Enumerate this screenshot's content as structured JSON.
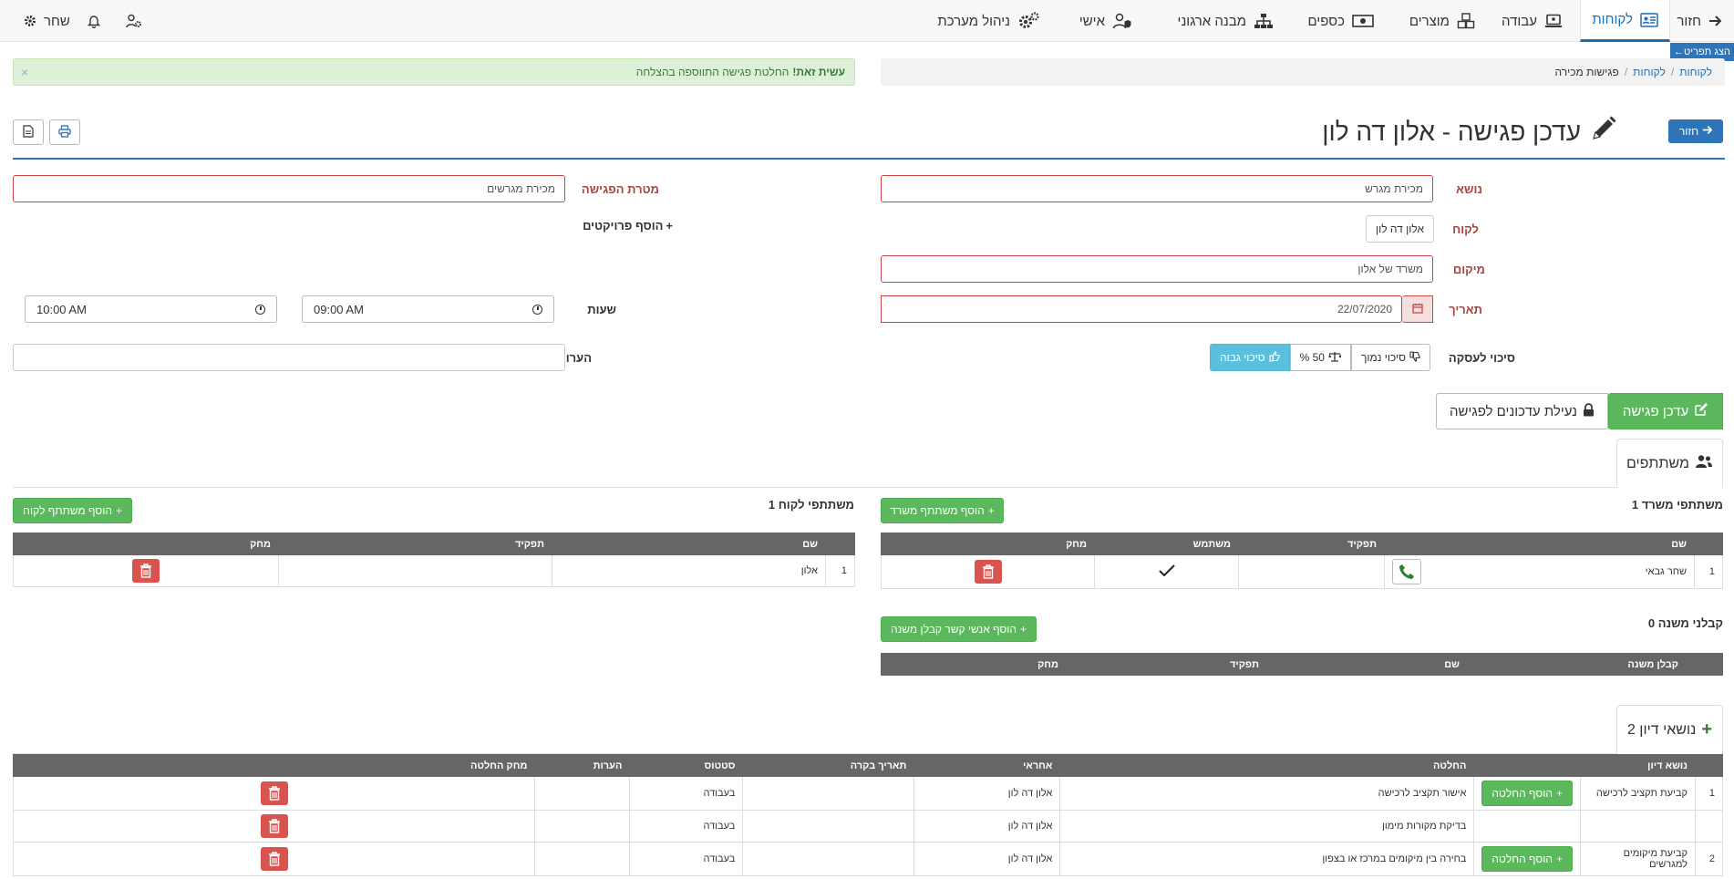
{
  "nav": {
    "back": "חזור",
    "customers": "לקוחות",
    "work": "עבודה",
    "products": "מוצרים",
    "finance": "כספים",
    "org": "מבנה ארגוני",
    "personal": "אישי",
    "admin": "ניהול מערכת",
    "user": "שחר",
    "show_params": "הצג תפריט←"
  },
  "breadcrumb": [
    "לקוחות",
    "לקוחות",
    "פגישות מכירה"
  ],
  "alert": {
    "strong": "עשית זאת!",
    "text": "החלטת פגישה התווספה בהצלחה",
    "close": "×"
  },
  "header": {
    "back": "חזור",
    "title": "עדכן פגישה - אלון דה לון"
  },
  "form": {
    "subject_label": "נושא",
    "subject_value": "מכירת מגרש",
    "goal_label": "מטרת הפגישה",
    "goal_value": "מכירת מגרשים",
    "customer_label": "לקוח",
    "customer_value": "אלון דה לון",
    "add_projects": "הוסף פרויקטים",
    "location_label": "מיקום",
    "location_value": "משרד של אלון",
    "date_label": "תאריך",
    "date_value": "22/07/2020",
    "hours_label": "שעות",
    "time_from": "09:00 AM",
    "time_to": "10:00 AM",
    "chance_label": "סיכוי לעסקה",
    "chance_low": "סיכוי נמוך",
    "chance_mid": "50 %",
    "chance_high": "סיכוי גבוה",
    "notes_label": "הערות",
    "notes_value": ""
  },
  "actions": {
    "update": "עדכן פגישה",
    "lock": "נעילת עדכונים לפגישה"
  },
  "participants": {
    "tab": "משתתפים",
    "office_title": "משתתפי משרד 1",
    "add_office": "הוסף משתתף משרד",
    "office_headers": [
      "שם",
      "תפקיד",
      "משתמש",
      "מחק"
    ],
    "office_rows": [
      {
        "num": "1",
        "name": "שחר גבאי",
        "role": ""
      }
    ],
    "customer_title": "משתתפי לקוח 1",
    "add_customer": "הוסף משתתף לקוח",
    "customer_headers": [
      "שם",
      "תפקיד",
      "מחק"
    ],
    "customer_rows": [
      {
        "num": "1",
        "name": "אלון",
        "role": ""
      }
    ],
    "sub_title": "קבלני משנה 0",
    "add_sub": "הוסף אנשי קשר קבלן משנה",
    "sub_headers": [
      "קבלן משנה",
      "שם",
      "תפקיד",
      "מחק"
    ]
  },
  "topics": {
    "tab": "נושאי דיון 2",
    "headers": [
      "נושא דיון",
      "החלטה",
      "אחראי",
      "תאריך בקרה",
      "סטטוס",
      "הערות",
      "מחק החלטה"
    ],
    "add_decision": "הוסף החלטה",
    "rows": [
      {
        "num": "1",
        "topic": "קביעת תקציב לרכישה",
        "decision": "אישור תקציב לרכישה",
        "owner": "אלון דה לון",
        "date": "",
        "status": "בעבודה",
        "notes": ""
      },
      {
        "num": "",
        "topic": "",
        "decision": "בדיקת מקורות מימון",
        "owner": "אלון דה לון",
        "date": "",
        "status": "בעבודה",
        "notes": ""
      },
      {
        "num": "2",
        "topic": "קביעת מיקומים למגרשים",
        "decision": "בחירה בין מיקומים במרכז או בצפון",
        "owner": "אלון דה לון",
        "date": "",
        "status": "בעבודה",
        "notes": ""
      }
    ]
  }
}
